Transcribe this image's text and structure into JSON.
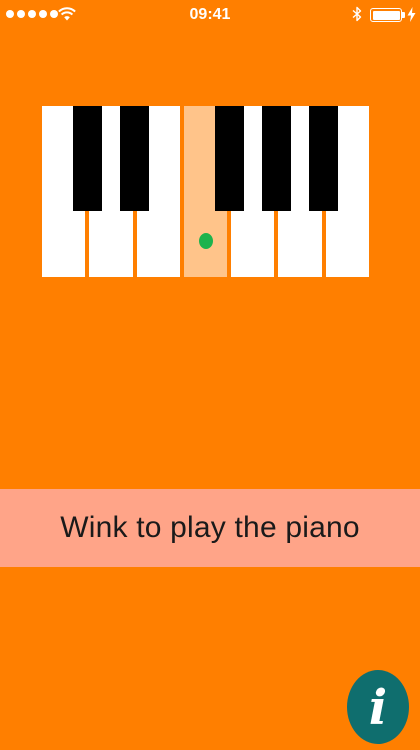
{
  "status_bar": {
    "time": "09:41",
    "signal_bars": 5,
    "battery_level": 1.0
  },
  "piano": {
    "white_keys": 7,
    "highlighted_white_key": 3,
    "black_key_after_white": [
      0,
      1,
      3,
      4,
      5
    ],
    "gaze_dot_key": 3
  },
  "instruction": {
    "text": "Wink to play the piano"
  },
  "info_button": {
    "glyph": "i"
  },
  "colors": {
    "background": "#FF7F00",
    "banner": "#FFA488",
    "highlight_key": "#FFC48A",
    "gaze_dot": "#1DB34D",
    "info_button": "#0F6E6E"
  },
  "icons": [
    "signal-icon",
    "wifi-icon",
    "bluetooth-icon",
    "battery-icon",
    "charging-icon",
    "info-icon"
  ]
}
